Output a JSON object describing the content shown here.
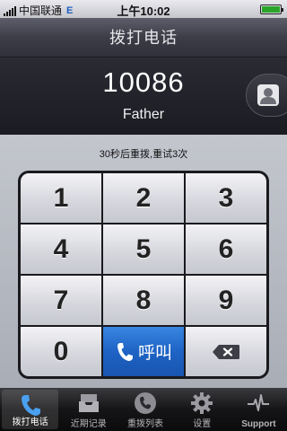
{
  "status_bar": {
    "carrier": "中国联通",
    "network": "E",
    "time": "上午10:02",
    "battery_level": 1.0
  },
  "title": "拨打电话",
  "display": {
    "number": "10086",
    "name": "Father"
  },
  "retry_text": "30秒后重拨,重试3次",
  "keypad": {
    "keys": [
      "1",
      "2",
      "3",
      "4",
      "5",
      "6",
      "7",
      "8",
      "9",
      "0"
    ],
    "call_label": "呼叫"
  },
  "tabs": [
    {
      "label": "拨打电话",
      "icon": "phone-icon",
      "active": true
    },
    {
      "label": "近期记录",
      "icon": "inbox-tray-icon",
      "active": false
    },
    {
      "label": "重拨列表",
      "icon": "phone-circle-icon",
      "active": false
    },
    {
      "label": "设置",
      "icon": "gear-icon",
      "active": false
    },
    {
      "label": "Support",
      "icon": "heartbeat-icon",
      "active": false
    }
  ],
  "colors": {
    "call_button": "#1e63c5",
    "title_bar": "#3c3d47"
  }
}
